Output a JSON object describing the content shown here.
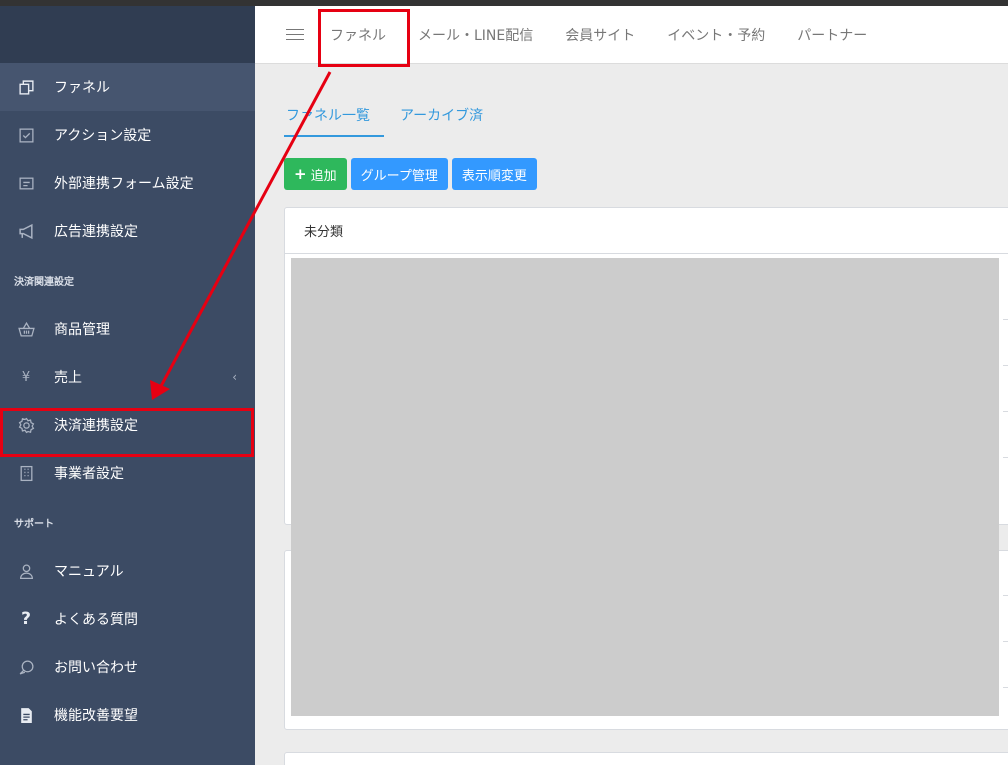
{
  "header": {
    "tabs": [
      {
        "label": "ファネル"
      },
      {
        "label": "メール・LINE配信"
      },
      {
        "label": "会員サイト"
      },
      {
        "label": "イベント・予約"
      },
      {
        "label": "パートナー"
      }
    ]
  },
  "sidebar": {
    "items": [
      {
        "label": "ファネル",
        "icon": "copy-icon"
      },
      {
        "label": "アクション設定",
        "icon": "checkbox-icon"
      },
      {
        "label": "外部連携フォーム設定",
        "icon": "form-icon"
      },
      {
        "label": "広告連携設定",
        "icon": "megaphone-icon"
      }
    ],
    "section_payment": "決済関連設定",
    "payment_items": [
      {
        "label": "商品管理",
        "icon": "basket-icon"
      },
      {
        "label": "売上",
        "icon": "yen-icon",
        "chevron": "‹"
      },
      {
        "label": "決済連携設定",
        "icon": "gear-icon"
      },
      {
        "label": "事業者設定",
        "icon": "building-icon"
      }
    ],
    "section_support": "サポート",
    "support_items": [
      {
        "label": "マニュアル",
        "icon": "user-icon"
      },
      {
        "label": "よくある質問",
        "icon": "question-icon"
      },
      {
        "label": "お問い合わせ",
        "icon": "chat-icon"
      },
      {
        "label": "機能改善要望",
        "icon": "document-icon"
      }
    ]
  },
  "main": {
    "subtabs": [
      {
        "label": "ファネル一覧"
      },
      {
        "label": "アーカイブ済"
      }
    ],
    "buttons": {
      "add": "追加",
      "group": "グループ管理",
      "order": "表示順変更"
    },
    "card_title": "未分類"
  },
  "colors": {
    "sidebar_bg": "#3c4b64",
    "accent_blue": "#3399ff",
    "green": "#2eb85c",
    "highlight_red": "#e60012"
  }
}
